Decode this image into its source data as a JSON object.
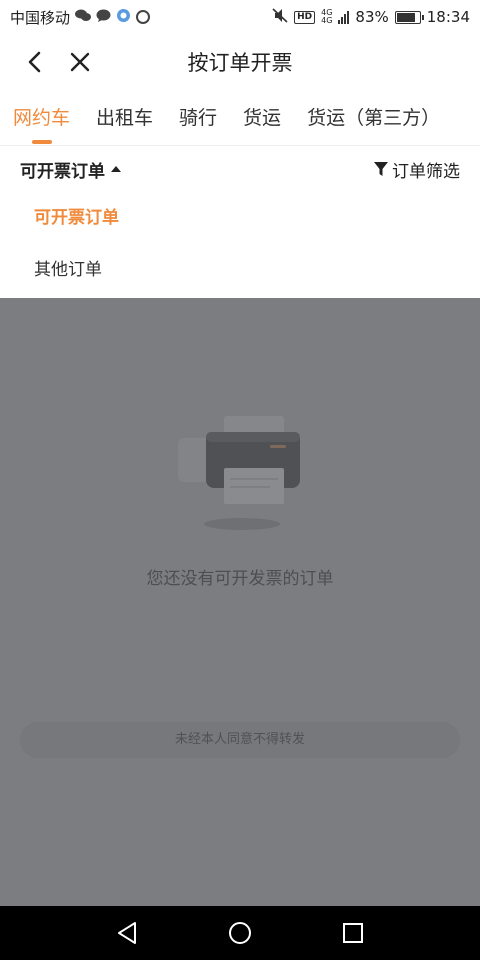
{
  "status_bar": {
    "carrier": "中国移动",
    "net_type_top": "4G",
    "net_type_bottom": "4G",
    "hd_label": "HD",
    "battery_percent": "83%",
    "time": "18:34"
  },
  "title_bar": {
    "title": "按订单开票"
  },
  "tabs": [
    {
      "label": "网约车",
      "active": true
    },
    {
      "label": "出租车",
      "active": false
    },
    {
      "label": "骑行",
      "active": false
    },
    {
      "label": "货运",
      "active": false
    },
    {
      "label": "货运（第三方）",
      "active": false
    }
  ],
  "filter": {
    "dropdown_label": "可开票订单",
    "order_filter_label": "订单筛选"
  },
  "menu": {
    "items": [
      {
        "label": "可开票订单",
        "selected": true
      },
      {
        "label": "其他订单",
        "selected": false
      }
    ]
  },
  "empty_state": {
    "message": "您还没有可开发票的订单"
  },
  "watermark": {
    "text": "未经本人同意不得转发"
  },
  "colors": {
    "accent": "#f08a3c",
    "overlay": "#7c7d81"
  }
}
